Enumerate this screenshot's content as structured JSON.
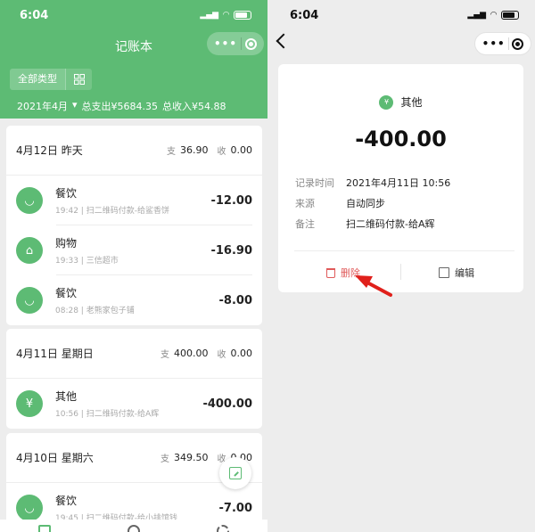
{
  "status": {
    "time_left": "6:04",
    "time_right": "6:04"
  },
  "header": {
    "title": "记账本",
    "filter_label": "全部类型",
    "month": "2021年4月",
    "month_caret": "▾",
    "total_expense": "总支出¥5684.35",
    "total_income": "总收入¥54.88"
  },
  "days": [
    {
      "date": "4月12日  昨天",
      "expense_tag": "支",
      "expense": "36.90",
      "income_tag": "收",
      "income": "0.00",
      "items": [
        {
          "icon": "bowl-icon",
          "glyph": "◡",
          "category": "餐饮",
          "time": "19:42",
          "note": "扫二维码付款-给鲨香饼",
          "amount": "-12.00"
        },
        {
          "icon": "shopping-bag-icon",
          "glyph": "⌂",
          "category": "购物",
          "time": "19:33",
          "note": "三信超市",
          "amount": "-16.90"
        },
        {
          "icon": "bowl-icon",
          "glyph": "◡",
          "category": "餐饮",
          "time": "08:28",
          "note": "老熊家包子铺",
          "amount": "-8.00"
        }
      ]
    },
    {
      "date": "4月11日  星期日",
      "expense_tag": "支",
      "expense": "400.00",
      "income_tag": "收",
      "income": "0.00",
      "items": [
        {
          "icon": "yen-icon",
          "glyph": "¥",
          "category": "其他",
          "time": "10:56",
          "note": "扫二维码付款-给A辉",
          "amount": "-400.00"
        }
      ]
    },
    {
      "date": "4月10日  星期六",
      "expense_tag": "支",
      "expense": "349.50",
      "income_tag": "收",
      "income": "0.00",
      "items": [
        {
          "icon": "bowl-icon",
          "glyph": "◡",
          "category": "餐饮",
          "time": "19:45",
          "note": "扫二维码付款-给小排馆钱",
          "amount": "-7.00"
        }
      ]
    }
  ],
  "detail": {
    "category": "其他",
    "category_glyph": "¥",
    "amount": "-400.00",
    "record_time_label": "记录时间",
    "record_time": "2021年4月11日 10:56",
    "source_label": "来源",
    "source": "自动同步",
    "remark_label": "备注",
    "remark": "扫二维码付款-给A辉",
    "delete_label": "删除",
    "edit_label": "编辑"
  },
  "colors": {
    "brand_green": "#5dbb74",
    "delete_red": "#e05a5a",
    "arrow_red": "#e0201b"
  }
}
